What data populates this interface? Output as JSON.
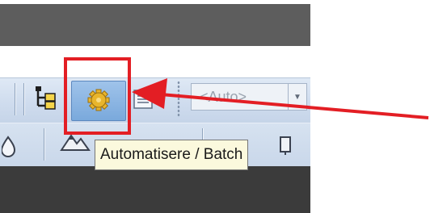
{
  "toolbar": {
    "view_combo": {
      "value": "<Auto>"
    },
    "tooltip": {
      "text": "Automatisere / Batch"
    }
  },
  "annotation": {
    "highlight_color": "#e31e24",
    "arrow_color": "#e31e24"
  },
  "icons": {
    "tree": "tree-structure-icon",
    "gear": "gear-icon",
    "sheet": "sheet-icon",
    "mountain": "mountain-icon",
    "drop": "drop-icon",
    "dropdown": "chevron-down-icon"
  },
  "colors": {
    "toolbar_bg": "#cfdcee",
    "active_button": "#8ab4e3",
    "tooltip_bg": "#fbf9dd",
    "dark_panel": "#5d5d5d"
  }
}
